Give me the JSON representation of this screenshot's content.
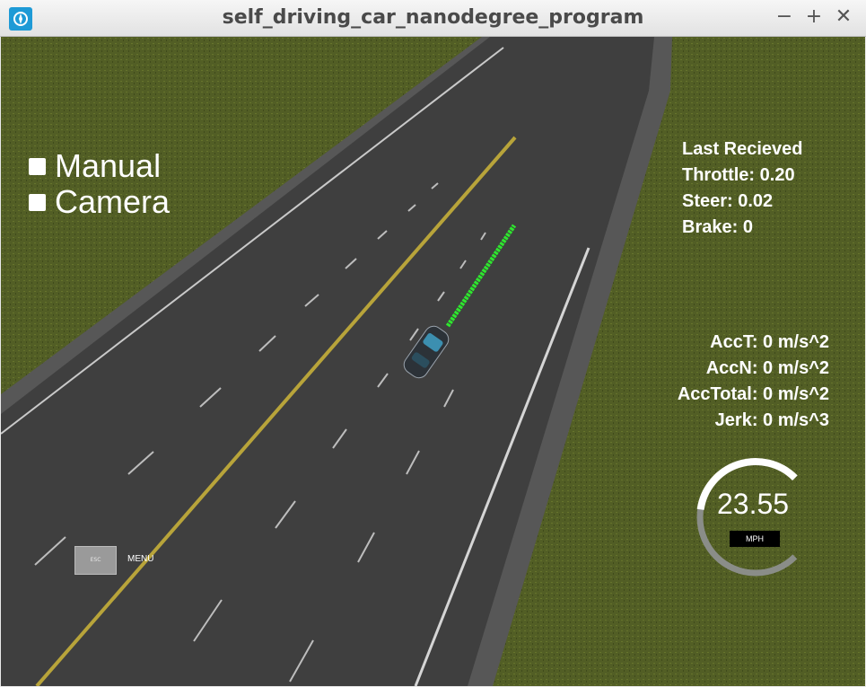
{
  "window": {
    "title": "self_driving_car_nanodegree_program",
    "controls": {
      "minimize": "−",
      "maximize": "+",
      "close": "✕"
    },
    "icon": "simulator-app-icon"
  },
  "toggles": [
    {
      "label": "Manual",
      "checked": false
    },
    {
      "label": "Camera",
      "checked": false
    }
  ],
  "last_received": {
    "heading": "Last Recieved",
    "throttle": "Throttle: 0.20",
    "steer": "Steer: 0.02",
    "brake": "Brake: 0"
  },
  "telemetry": {
    "acc_t": "AccT: 0 m/s^2",
    "acc_n": "AccN: 0 m/s^2",
    "acc_total": "AccTotal: 0 m/s^2",
    "jerk": "Jerk: 0 m/s^3"
  },
  "speedometer": {
    "value": "23.55",
    "unit": "MPH",
    "fill_fraction": 0.47
  },
  "menu": {
    "esc_label": "ESC",
    "menu_label": "MENU"
  },
  "colors": {
    "grass": "#4e5a22",
    "road": "#3d3d3d",
    "yellow_line": "#b8a43a",
    "planned_path": "#2ee62e"
  }
}
